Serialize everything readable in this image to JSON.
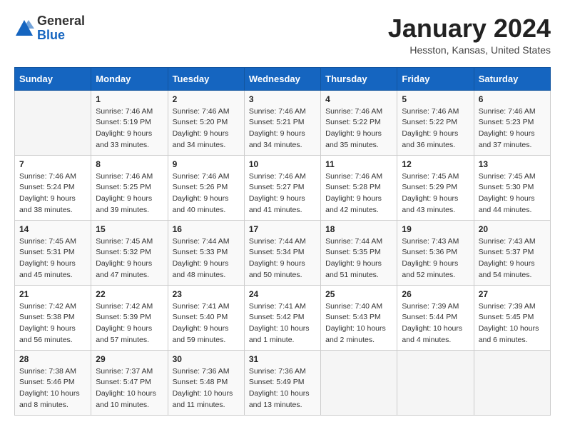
{
  "header": {
    "logo": {
      "line1": "General",
      "line2": "Blue"
    },
    "title": "January 2024",
    "subtitle": "Hesston, Kansas, United States"
  },
  "calendar": {
    "days_of_week": [
      "Sunday",
      "Monday",
      "Tuesday",
      "Wednesday",
      "Thursday",
      "Friday",
      "Saturday"
    ],
    "weeks": [
      {
        "days": [
          {
            "number": "",
            "info": ""
          },
          {
            "number": "1",
            "info": "Sunrise: 7:46 AM\nSunset: 5:19 PM\nDaylight: 9 hours\nand 33 minutes."
          },
          {
            "number": "2",
            "info": "Sunrise: 7:46 AM\nSunset: 5:20 PM\nDaylight: 9 hours\nand 34 minutes."
          },
          {
            "number": "3",
            "info": "Sunrise: 7:46 AM\nSunset: 5:21 PM\nDaylight: 9 hours\nand 34 minutes."
          },
          {
            "number": "4",
            "info": "Sunrise: 7:46 AM\nSunset: 5:22 PM\nDaylight: 9 hours\nand 35 minutes."
          },
          {
            "number": "5",
            "info": "Sunrise: 7:46 AM\nSunset: 5:22 PM\nDaylight: 9 hours\nand 36 minutes."
          },
          {
            "number": "6",
            "info": "Sunrise: 7:46 AM\nSunset: 5:23 PM\nDaylight: 9 hours\nand 37 minutes."
          }
        ]
      },
      {
        "days": [
          {
            "number": "7",
            "info": "Sunrise: 7:46 AM\nSunset: 5:24 PM\nDaylight: 9 hours\nand 38 minutes."
          },
          {
            "number": "8",
            "info": "Sunrise: 7:46 AM\nSunset: 5:25 PM\nDaylight: 9 hours\nand 39 minutes."
          },
          {
            "number": "9",
            "info": "Sunrise: 7:46 AM\nSunset: 5:26 PM\nDaylight: 9 hours\nand 40 minutes."
          },
          {
            "number": "10",
            "info": "Sunrise: 7:46 AM\nSunset: 5:27 PM\nDaylight: 9 hours\nand 41 minutes."
          },
          {
            "number": "11",
            "info": "Sunrise: 7:46 AM\nSunset: 5:28 PM\nDaylight: 9 hours\nand 42 minutes."
          },
          {
            "number": "12",
            "info": "Sunrise: 7:45 AM\nSunset: 5:29 PM\nDaylight: 9 hours\nand 43 minutes."
          },
          {
            "number": "13",
            "info": "Sunrise: 7:45 AM\nSunset: 5:30 PM\nDaylight: 9 hours\nand 44 minutes."
          }
        ]
      },
      {
        "days": [
          {
            "number": "14",
            "info": "Sunrise: 7:45 AM\nSunset: 5:31 PM\nDaylight: 9 hours\nand 45 minutes."
          },
          {
            "number": "15",
            "info": "Sunrise: 7:45 AM\nSunset: 5:32 PM\nDaylight: 9 hours\nand 47 minutes."
          },
          {
            "number": "16",
            "info": "Sunrise: 7:44 AM\nSunset: 5:33 PM\nDaylight: 9 hours\nand 48 minutes."
          },
          {
            "number": "17",
            "info": "Sunrise: 7:44 AM\nSunset: 5:34 PM\nDaylight: 9 hours\nand 50 minutes."
          },
          {
            "number": "18",
            "info": "Sunrise: 7:44 AM\nSunset: 5:35 PM\nDaylight: 9 hours\nand 51 minutes."
          },
          {
            "number": "19",
            "info": "Sunrise: 7:43 AM\nSunset: 5:36 PM\nDaylight: 9 hours\nand 52 minutes."
          },
          {
            "number": "20",
            "info": "Sunrise: 7:43 AM\nSunset: 5:37 PM\nDaylight: 9 hours\nand 54 minutes."
          }
        ]
      },
      {
        "days": [
          {
            "number": "21",
            "info": "Sunrise: 7:42 AM\nSunset: 5:38 PM\nDaylight: 9 hours\nand 56 minutes."
          },
          {
            "number": "22",
            "info": "Sunrise: 7:42 AM\nSunset: 5:39 PM\nDaylight: 9 hours\nand 57 minutes."
          },
          {
            "number": "23",
            "info": "Sunrise: 7:41 AM\nSunset: 5:40 PM\nDaylight: 9 hours\nand 59 minutes."
          },
          {
            "number": "24",
            "info": "Sunrise: 7:41 AM\nSunset: 5:42 PM\nDaylight: 10 hours\nand 1 minute."
          },
          {
            "number": "25",
            "info": "Sunrise: 7:40 AM\nSunset: 5:43 PM\nDaylight: 10 hours\nand 2 minutes."
          },
          {
            "number": "26",
            "info": "Sunrise: 7:39 AM\nSunset: 5:44 PM\nDaylight: 10 hours\nand 4 minutes."
          },
          {
            "number": "27",
            "info": "Sunrise: 7:39 AM\nSunset: 5:45 PM\nDaylight: 10 hours\nand 6 minutes."
          }
        ]
      },
      {
        "days": [
          {
            "number": "28",
            "info": "Sunrise: 7:38 AM\nSunset: 5:46 PM\nDaylight: 10 hours\nand 8 minutes."
          },
          {
            "number": "29",
            "info": "Sunrise: 7:37 AM\nSunset: 5:47 PM\nDaylight: 10 hours\nand 10 minutes."
          },
          {
            "number": "30",
            "info": "Sunrise: 7:36 AM\nSunset: 5:48 PM\nDaylight: 10 hours\nand 11 minutes."
          },
          {
            "number": "31",
            "info": "Sunrise: 7:36 AM\nSunset: 5:49 PM\nDaylight: 10 hours\nand 13 minutes."
          },
          {
            "number": "",
            "info": ""
          },
          {
            "number": "",
            "info": ""
          },
          {
            "number": "",
            "info": ""
          }
        ]
      }
    ]
  }
}
